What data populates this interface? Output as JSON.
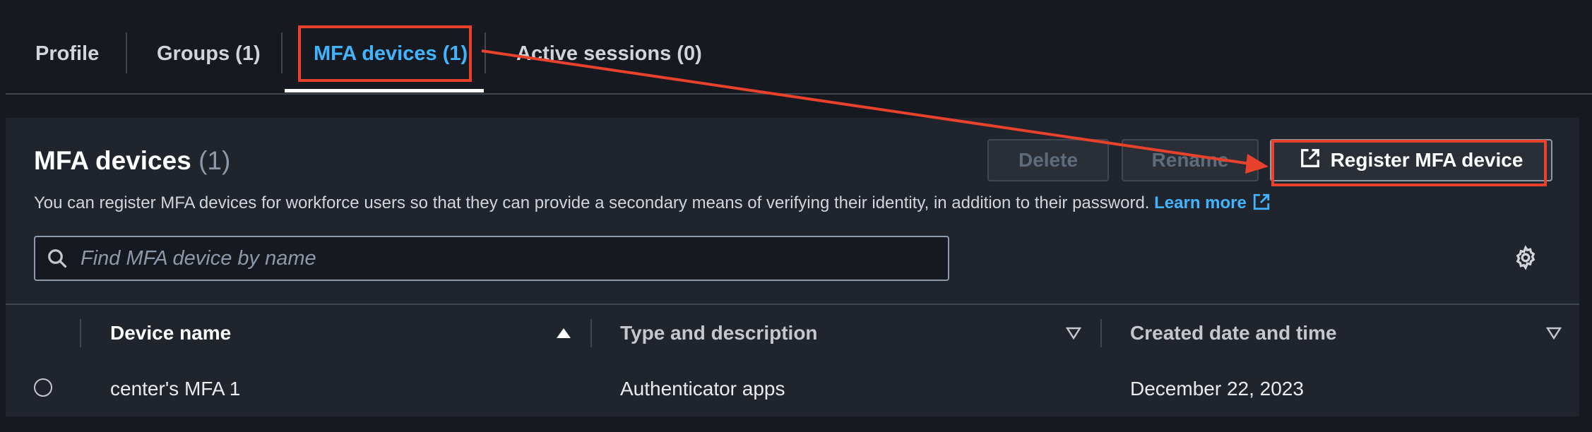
{
  "tabs": [
    {
      "label": "Profile"
    },
    {
      "label": "Groups (1)"
    },
    {
      "label": "MFA devices (1)"
    },
    {
      "label": "Active sessions (0)"
    }
  ],
  "panel": {
    "title": "MFA devices",
    "count": "(1)",
    "description": "You can register MFA devices for workforce users so that they can provide a secondary means of verifying their identity, in addition to their password.",
    "learn_more": "Learn more"
  },
  "buttons": {
    "delete": "Delete",
    "rename": "Rename",
    "register": "Register MFA device"
  },
  "search": {
    "placeholder": "Find MFA device by name"
  },
  "table": {
    "columns": [
      "Device name",
      "Type and description",
      "Created date and time"
    ],
    "rows": [
      {
        "name": "center's MFA 1",
        "type": "Authenticator apps",
        "created": "December 22, 2023"
      }
    ]
  },
  "colors": {
    "accent": "#42b4ff",
    "annotation": "#e8412c"
  }
}
